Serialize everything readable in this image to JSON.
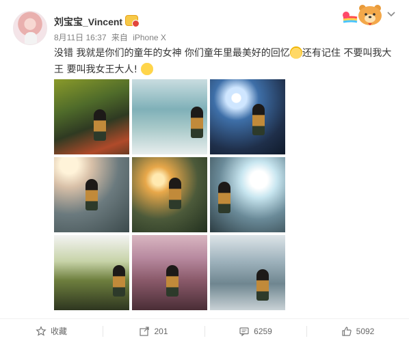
{
  "user": {
    "name": "刘宝宝_Vincent"
  },
  "post": {
    "date": "8月11日 16:37",
    "source_prefix": "来自",
    "source": "iPhone X",
    "text_part1": "没错 我就是你们的童年的女神 你们童年里最美好的回忆",
    "text_part2": "还有记住 不要叫我大王 要叫我女王大人!",
    "emoji_1": "cat-emoji",
    "emoji_2": "smile-emoji",
    "photo_count": 9
  },
  "actions": {
    "favorite_label": "收藏",
    "repost_count": "201",
    "comment_count": "6259",
    "like_count": "5092"
  },
  "icons": {
    "star": "star-icon",
    "repost": "repost-icon",
    "comment": "comment-icon",
    "like": "thumbs-up-icon",
    "menu": "chevron-down-icon"
  }
}
